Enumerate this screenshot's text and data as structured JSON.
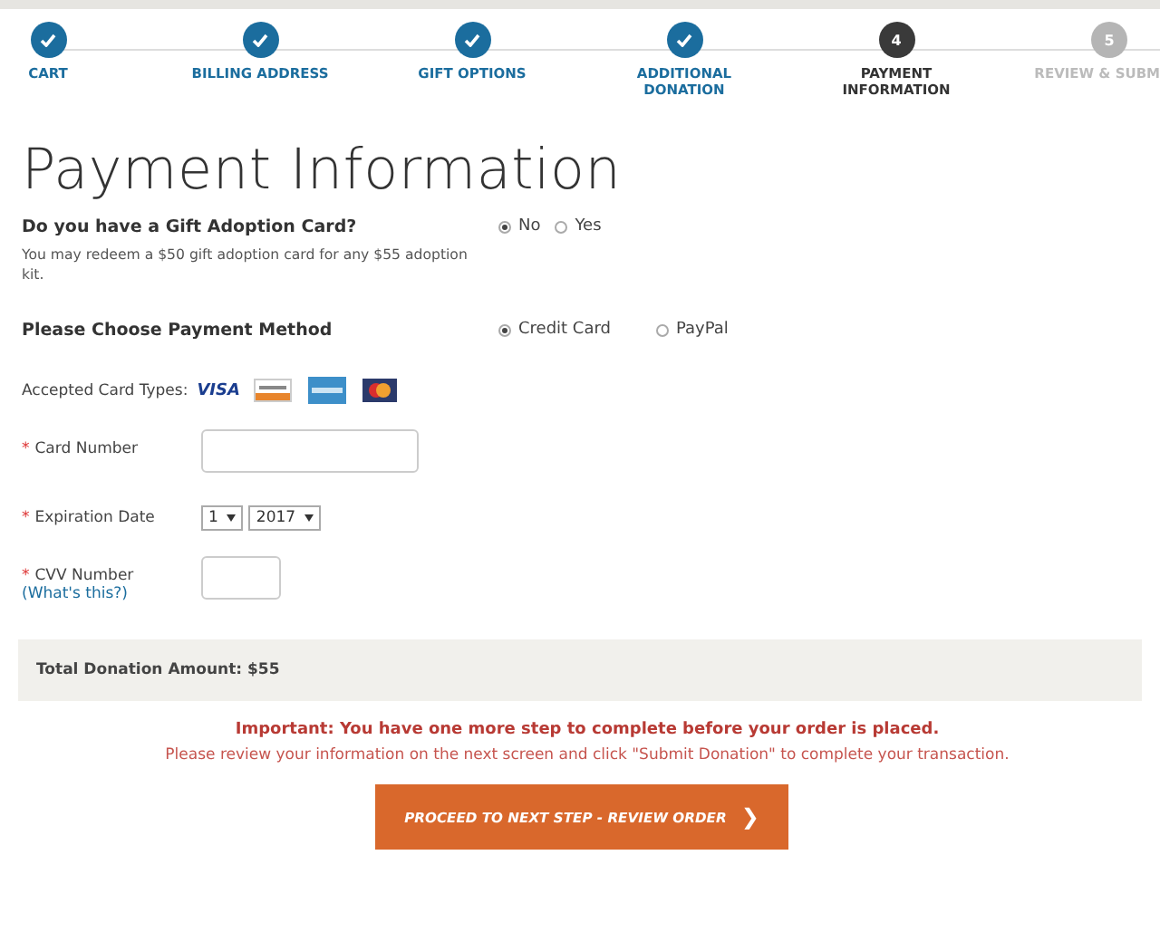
{
  "steps": [
    {
      "label": "CART",
      "kind": "done"
    },
    {
      "label": "BILLING ADDRESS",
      "kind": "done"
    },
    {
      "label": "GIFT OPTIONS",
      "kind": "done"
    },
    {
      "label": "ADDITIONAL DONATION",
      "kind": "done"
    },
    {
      "label": "PAYMENT INFORMATION",
      "number": "4",
      "kind": "current"
    },
    {
      "label": "REVIEW & SUBM",
      "number": "5",
      "kind": "upcoming"
    }
  ],
  "title": "Payment Information",
  "gift_card": {
    "question": "Do you have a Gift Adoption Card?",
    "note": "You may redeem a $50 gift adoption card for any $55 adoption kit.",
    "options": [
      {
        "label": "No",
        "selected": true
      },
      {
        "label": "Yes",
        "selected": false
      }
    ]
  },
  "payment_method": {
    "label": "Please Choose Payment Method",
    "options": [
      {
        "label": "Credit Card",
        "selected": true
      },
      {
        "label": "PayPal",
        "selected": false
      }
    ]
  },
  "accepted_cards": {
    "label": "Accepted Card Types:",
    "cards": [
      {
        "kind": "visa",
        "label": "VISA"
      },
      {
        "kind": "discover"
      },
      {
        "kind": "amex"
      },
      {
        "kind": "mastercard"
      }
    ]
  },
  "fields": [
    {
      "kind": "input",
      "required_mark": "*",
      "label": "Card Number"
    },
    {
      "kind": "selects",
      "required_mark": "*",
      "label": "Expiration Date",
      "selects": [
        "1",
        "2017"
      ]
    },
    {
      "kind": "short_input",
      "required_mark": "*",
      "label": "CVV Number",
      "link": "(What's this?)"
    }
  ],
  "total": "Total Donation Amount: $55",
  "notice": {
    "heading": "Important: You have one more step to complete before your order is placed.",
    "text": "Please review your information on the next screen and click \"Submit Donation\" to complete your transaction."
  },
  "proceed_button": {
    "label": "PROCEED TO NEXT STEP - REVIEW ORDER",
    "arrow": "❯"
  }
}
